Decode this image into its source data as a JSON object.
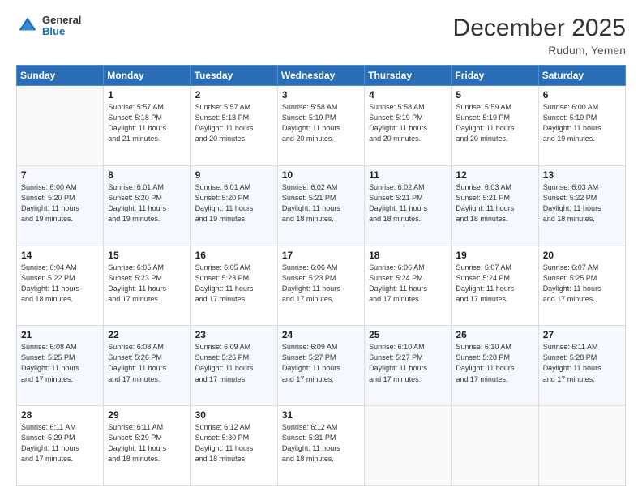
{
  "header": {
    "title": "December 2025",
    "subtitle": "Rudum, Yemen",
    "logo_general": "General",
    "logo_blue": "Blue"
  },
  "days_of_week": [
    "Sunday",
    "Monday",
    "Tuesday",
    "Wednesday",
    "Thursday",
    "Friday",
    "Saturday"
  ],
  "weeks": [
    [
      {
        "day": "",
        "detail": ""
      },
      {
        "day": "1",
        "detail": "Sunrise: 5:57 AM\nSunset: 5:18 PM\nDaylight: 11 hours\nand 21 minutes."
      },
      {
        "day": "2",
        "detail": "Sunrise: 5:57 AM\nSunset: 5:18 PM\nDaylight: 11 hours\nand 20 minutes."
      },
      {
        "day": "3",
        "detail": "Sunrise: 5:58 AM\nSunset: 5:19 PM\nDaylight: 11 hours\nand 20 minutes."
      },
      {
        "day": "4",
        "detail": "Sunrise: 5:58 AM\nSunset: 5:19 PM\nDaylight: 11 hours\nand 20 minutes."
      },
      {
        "day": "5",
        "detail": "Sunrise: 5:59 AM\nSunset: 5:19 PM\nDaylight: 11 hours\nand 20 minutes."
      },
      {
        "day": "6",
        "detail": "Sunrise: 6:00 AM\nSunset: 5:19 PM\nDaylight: 11 hours\nand 19 minutes."
      }
    ],
    [
      {
        "day": "7",
        "detail": "Sunrise: 6:00 AM\nSunset: 5:20 PM\nDaylight: 11 hours\nand 19 minutes."
      },
      {
        "day": "8",
        "detail": "Sunrise: 6:01 AM\nSunset: 5:20 PM\nDaylight: 11 hours\nand 19 minutes."
      },
      {
        "day": "9",
        "detail": "Sunrise: 6:01 AM\nSunset: 5:20 PM\nDaylight: 11 hours\nand 19 minutes."
      },
      {
        "day": "10",
        "detail": "Sunrise: 6:02 AM\nSunset: 5:21 PM\nDaylight: 11 hours\nand 18 minutes."
      },
      {
        "day": "11",
        "detail": "Sunrise: 6:02 AM\nSunset: 5:21 PM\nDaylight: 11 hours\nand 18 minutes."
      },
      {
        "day": "12",
        "detail": "Sunrise: 6:03 AM\nSunset: 5:21 PM\nDaylight: 11 hours\nand 18 minutes."
      },
      {
        "day": "13",
        "detail": "Sunrise: 6:03 AM\nSunset: 5:22 PM\nDaylight: 11 hours\nand 18 minutes."
      }
    ],
    [
      {
        "day": "14",
        "detail": "Sunrise: 6:04 AM\nSunset: 5:22 PM\nDaylight: 11 hours\nand 18 minutes."
      },
      {
        "day": "15",
        "detail": "Sunrise: 6:05 AM\nSunset: 5:23 PM\nDaylight: 11 hours\nand 17 minutes."
      },
      {
        "day": "16",
        "detail": "Sunrise: 6:05 AM\nSunset: 5:23 PM\nDaylight: 11 hours\nand 17 minutes."
      },
      {
        "day": "17",
        "detail": "Sunrise: 6:06 AM\nSunset: 5:23 PM\nDaylight: 11 hours\nand 17 minutes."
      },
      {
        "day": "18",
        "detail": "Sunrise: 6:06 AM\nSunset: 5:24 PM\nDaylight: 11 hours\nand 17 minutes."
      },
      {
        "day": "19",
        "detail": "Sunrise: 6:07 AM\nSunset: 5:24 PM\nDaylight: 11 hours\nand 17 minutes."
      },
      {
        "day": "20",
        "detail": "Sunrise: 6:07 AM\nSunset: 5:25 PM\nDaylight: 11 hours\nand 17 minutes."
      }
    ],
    [
      {
        "day": "21",
        "detail": "Sunrise: 6:08 AM\nSunset: 5:25 PM\nDaylight: 11 hours\nand 17 minutes."
      },
      {
        "day": "22",
        "detail": "Sunrise: 6:08 AM\nSunset: 5:26 PM\nDaylight: 11 hours\nand 17 minutes."
      },
      {
        "day": "23",
        "detail": "Sunrise: 6:09 AM\nSunset: 5:26 PM\nDaylight: 11 hours\nand 17 minutes."
      },
      {
        "day": "24",
        "detail": "Sunrise: 6:09 AM\nSunset: 5:27 PM\nDaylight: 11 hours\nand 17 minutes."
      },
      {
        "day": "25",
        "detail": "Sunrise: 6:10 AM\nSunset: 5:27 PM\nDaylight: 11 hours\nand 17 minutes."
      },
      {
        "day": "26",
        "detail": "Sunrise: 6:10 AM\nSunset: 5:28 PM\nDaylight: 11 hours\nand 17 minutes."
      },
      {
        "day": "27",
        "detail": "Sunrise: 6:11 AM\nSunset: 5:28 PM\nDaylight: 11 hours\nand 17 minutes."
      }
    ],
    [
      {
        "day": "28",
        "detail": "Sunrise: 6:11 AM\nSunset: 5:29 PM\nDaylight: 11 hours\nand 17 minutes."
      },
      {
        "day": "29",
        "detail": "Sunrise: 6:11 AM\nSunset: 5:29 PM\nDaylight: 11 hours\nand 18 minutes."
      },
      {
        "day": "30",
        "detail": "Sunrise: 6:12 AM\nSunset: 5:30 PM\nDaylight: 11 hours\nand 18 minutes."
      },
      {
        "day": "31",
        "detail": "Sunrise: 6:12 AM\nSunset: 5:31 PM\nDaylight: 11 hours\nand 18 minutes."
      },
      {
        "day": "",
        "detail": ""
      },
      {
        "day": "",
        "detail": ""
      },
      {
        "day": "",
        "detail": ""
      }
    ]
  ]
}
